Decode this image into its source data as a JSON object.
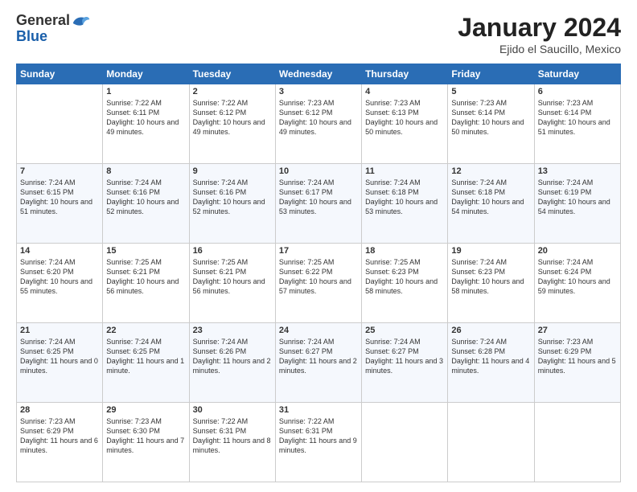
{
  "header": {
    "logo_general": "General",
    "logo_blue": "Blue",
    "title": "January 2024",
    "location": "Ejido el Saucillo, Mexico"
  },
  "days_of_week": [
    "Sunday",
    "Monday",
    "Tuesday",
    "Wednesday",
    "Thursday",
    "Friday",
    "Saturday"
  ],
  "weeks": [
    [
      {
        "num": "",
        "info": ""
      },
      {
        "num": "1",
        "info": "Sunrise: 7:22 AM\nSunset: 6:11 PM\nDaylight: 10 hours\nand 49 minutes."
      },
      {
        "num": "2",
        "info": "Sunrise: 7:22 AM\nSunset: 6:12 PM\nDaylight: 10 hours\nand 49 minutes."
      },
      {
        "num": "3",
        "info": "Sunrise: 7:23 AM\nSunset: 6:12 PM\nDaylight: 10 hours\nand 49 minutes."
      },
      {
        "num": "4",
        "info": "Sunrise: 7:23 AM\nSunset: 6:13 PM\nDaylight: 10 hours\nand 50 minutes."
      },
      {
        "num": "5",
        "info": "Sunrise: 7:23 AM\nSunset: 6:14 PM\nDaylight: 10 hours\nand 50 minutes."
      },
      {
        "num": "6",
        "info": "Sunrise: 7:23 AM\nSunset: 6:14 PM\nDaylight: 10 hours\nand 51 minutes."
      }
    ],
    [
      {
        "num": "7",
        "info": "Sunrise: 7:24 AM\nSunset: 6:15 PM\nDaylight: 10 hours\nand 51 minutes."
      },
      {
        "num": "8",
        "info": "Sunrise: 7:24 AM\nSunset: 6:16 PM\nDaylight: 10 hours\nand 52 minutes."
      },
      {
        "num": "9",
        "info": "Sunrise: 7:24 AM\nSunset: 6:16 PM\nDaylight: 10 hours\nand 52 minutes."
      },
      {
        "num": "10",
        "info": "Sunrise: 7:24 AM\nSunset: 6:17 PM\nDaylight: 10 hours\nand 53 minutes."
      },
      {
        "num": "11",
        "info": "Sunrise: 7:24 AM\nSunset: 6:18 PM\nDaylight: 10 hours\nand 53 minutes."
      },
      {
        "num": "12",
        "info": "Sunrise: 7:24 AM\nSunset: 6:18 PM\nDaylight: 10 hours\nand 54 minutes."
      },
      {
        "num": "13",
        "info": "Sunrise: 7:24 AM\nSunset: 6:19 PM\nDaylight: 10 hours\nand 54 minutes."
      }
    ],
    [
      {
        "num": "14",
        "info": "Sunrise: 7:24 AM\nSunset: 6:20 PM\nDaylight: 10 hours\nand 55 minutes."
      },
      {
        "num": "15",
        "info": "Sunrise: 7:25 AM\nSunset: 6:21 PM\nDaylight: 10 hours\nand 56 minutes."
      },
      {
        "num": "16",
        "info": "Sunrise: 7:25 AM\nSunset: 6:21 PM\nDaylight: 10 hours\nand 56 minutes."
      },
      {
        "num": "17",
        "info": "Sunrise: 7:25 AM\nSunset: 6:22 PM\nDaylight: 10 hours\nand 57 minutes."
      },
      {
        "num": "18",
        "info": "Sunrise: 7:25 AM\nSunset: 6:23 PM\nDaylight: 10 hours\nand 58 minutes."
      },
      {
        "num": "19",
        "info": "Sunrise: 7:24 AM\nSunset: 6:23 PM\nDaylight: 10 hours\nand 58 minutes."
      },
      {
        "num": "20",
        "info": "Sunrise: 7:24 AM\nSunset: 6:24 PM\nDaylight: 10 hours\nand 59 minutes."
      }
    ],
    [
      {
        "num": "21",
        "info": "Sunrise: 7:24 AM\nSunset: 6:25 PM\nDaylight: 11 hours\nand 0 minutes."
      },
      {
        "num": "22",
        "info": "Sunrise: 7:24 AM\nSunset: 6:25 PM\nDaylight: 11 hours\nand 1 minute."
      },
      {
        "num": "23",
        "info": "Sunrise: 7:24 AM\nSunset: 6:26 PM\nDaylight: 11 hours\nand 2 minutes."
      },
      {
        "num": "24",
        "info": "Sunrise: 7:24 AM\nSunset: 6:27 PM\nDaylight: 11 hours\nand 2 minutes."
      },
      {
        "num": "25",
        "info": "Sunrise: 7:24 AM\nSunset: 6:27 PM\nDaylight: 11 hours\nand 3 minutes."
      },
      {
        "num": "26",
        "info": "Sunrise: 7:24 AM\nSunset: 6:28 PM\nDaylight: 11 hours\nand 4 minutes."
      },
      {
        "num": "27",
        "info": "Sunrise: 7:23 AM\nSunset: 6:29 PM\nDaylight: 11 hours\nand 5 minutes."
      }
    ],
    [
      {
        "num": "28",
        "info": "Sunrise: 7:23 AM\nSunset: 6:29 PM\nDaylight: 11 hours\nand 6 minutes."
      },
      {
        "num": "29",
        "info": "Sunrise: 7:23 AM\nSunset: 6:30 PM\nDaylight: 11 hours\nand 7 minutes."
      },
      {
        "num": "30",
        "info": "Sunrise: 7:22 AM\nSunset: 6:31 PM\nDaylight: 11 hours\nand 8 minutes."
      },
      {
        "num": "31",
        "info": "Sunrise: 7:22 AM\nSunset: 6:31 PM\nDaylight: 11 hours\nand 9 minutes."
      },
      {
        "num": "",
        "info": ""
      },
      {
        "num": "",
        "info": ""
      },
      {
        "num": "",
        "info": ""
      }
    ]
  ]
}
